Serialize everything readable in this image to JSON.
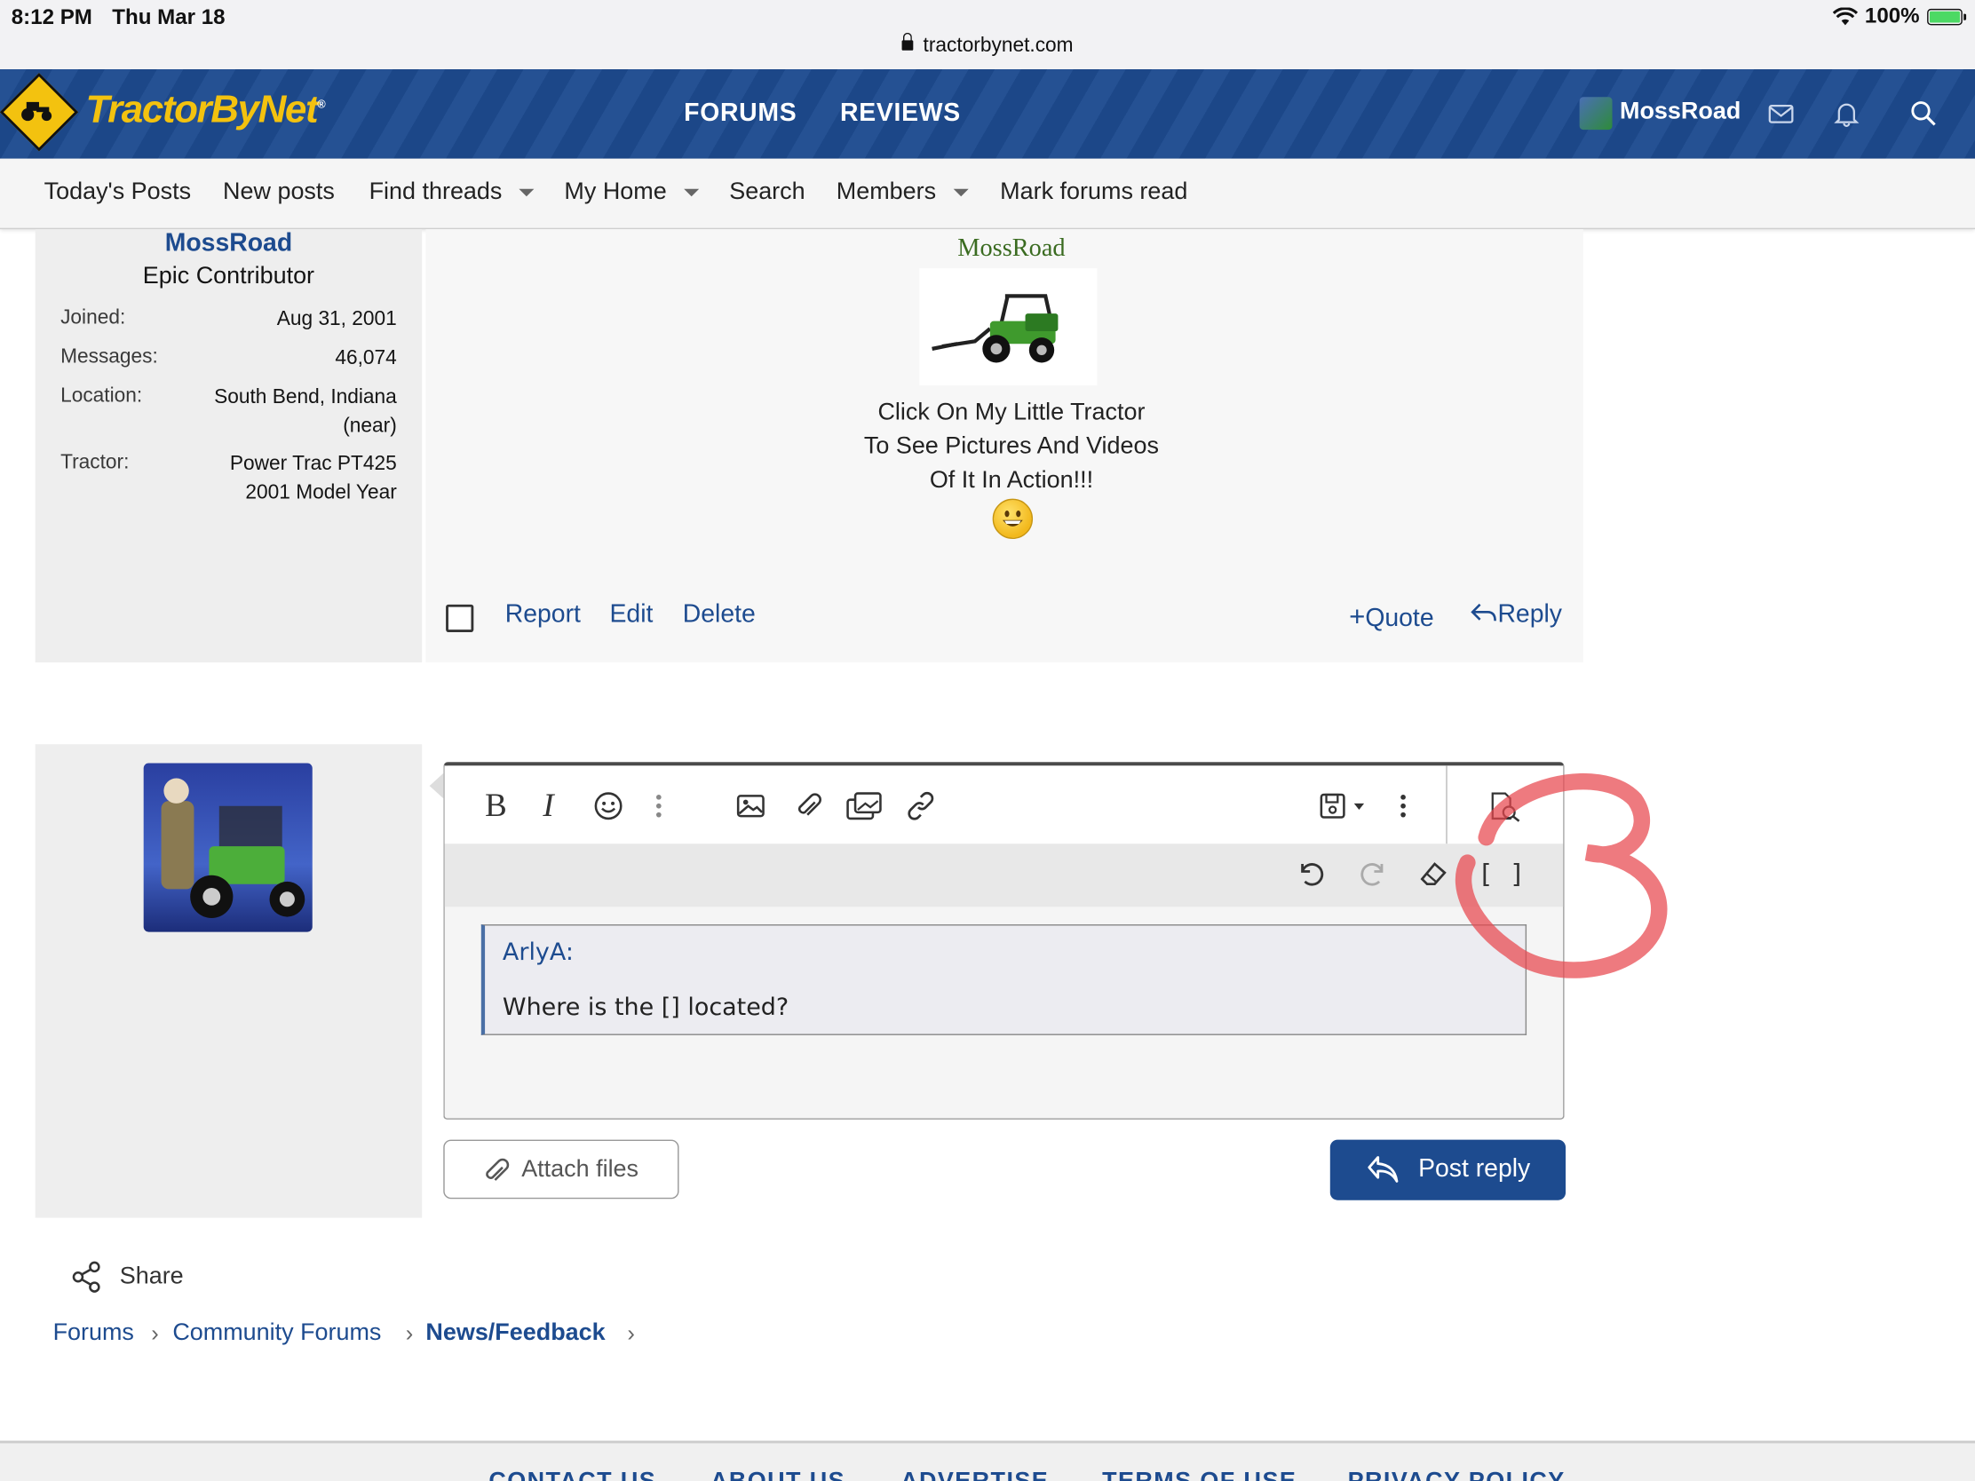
{
  "statusbar": {
    "time": "8:12 PM",
    "date": "Thu Mar 18",
    "url": "tractorbynet.com",
    "battery": "100%"
  },
  "header": {
    "logo_text": "TractorByNet",
    "nav": [
      "FORUMS",
      "REVIEWS"
    ],
    "username": "MossRoad",
    "icons": [
      "envelope-icon",
      "bell-icon",
      "search-icon"
    ],
    "accent_color": "#1d4b8f",
    "logo_color": "#f3c20f"
  },
  "subnav": {
    "items": [
      {
        "label": "Today's Posts"
      },
      {
        "label": "New posts"
      },
      {
        "label": "Find threads"
      },
      {
        "label": "My Home"
      },
      {
        "label": "Search"
      },
      {
        "label": "Members"
      },
      {
        "label": "Mark forums read"
      }
    ]
  },
  "post": {
    "username": "MossRoad",
    "user_title": "Epic Contributor",
    "stats": [
      {
        "key": "Joined:",
        "value": "Aug 31, 2001"
      },
      {
        "key": "Messages:",
        "value": "46,074"
      },
      {
        "key": "Location:",
        "value": "South Bend, Indiana (near)"
      },
      {
        "key": "Tractor:",
        "value": "Power Trac PT425 2001 Model Year"
      }
    ],
    "signature_name": "MossRoad",
    "signature_lines": [
      "Click On My Little Tractor",
      "To See Pictures And Videos",
      "Of It In Action!!!"
    ],
    "actions_left": [
      "Report",
      "Edit",
      "Delete"
    ],
    "actions_right": [
      "Quote",
      "Reply"
    ]
  },
  "editor": {
    "toolbar_row1": [
      "bold-icon",
      "italic-icon",
      "smiley-icon",
      "more-vertical-icon",
      "image-icon",
      "attachment-icon",
      "media-icon",
      "link-icon",
      "save-draft-icon",
      "more-options-icon",
      "preview-icon"
    ],
    "toolbar_row2": [
      "undo-icon",
      "redo-icon",
      "remove-format-icon",
      "bbcode-toggle-icon"
    ],
    "bbcode_label": "[ ]",
    "quote_author": "ArlyA:",
    "quote_text": "Where is the  [] located?"
  },
  "buttons": {
    "attach": "Attach files",
    "post_reply": "Post reply"
  },
  "share_label": "Share",
  "breadcrumb": [
    "Forums",
    "Community Forums",
    "News/Feedback"
  ],
  "footer": [
    "CONTACT US",
    "ABOUT US",
    "ADVERTISE",
    "TERMS OF USE",
    "PRIVACY POLICY"
  ]
}
